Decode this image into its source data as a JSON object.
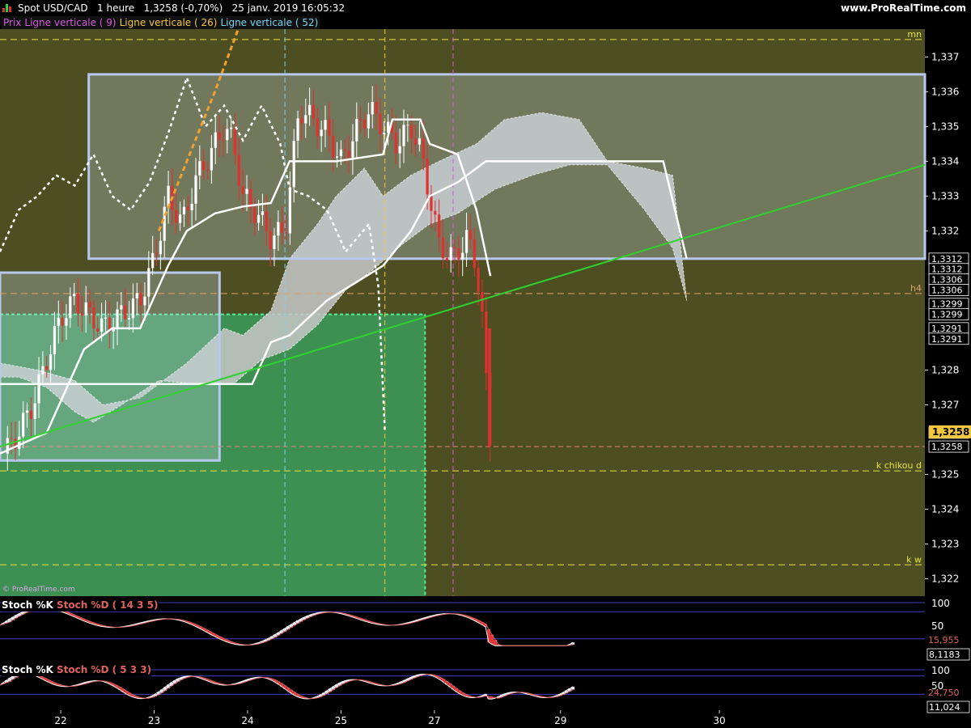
{
  "header": {
    "title": "Spot USD/CAD   1 heure   1,3258 (-0,70%)   25 janv. 2019 16:05:32",
    "brand": "www.ProRealTime.com",
    "watermark": "© ProRealTime.com"
  },
  "legend": [
    {
      "text": "Prix",
      "color": "#d65adf"
    },
    {
      "text": "Ligne verticale ( 9)",
      "color": "#d65adf"
    },
    {
      "text": "Ligne verticale ( 26)",
      "color": "#f2c640"
    },
    {
      "text": "Ligne verticale ( 52)",
      "color": "#7ad3f0"
    }
  ],
  "colors": {
    "background": "#4d4f22",
    "cloud": "#c8c8c8",
    "trendline": "#2ed22e",
    "box": "#b7c8ee",
    "level": "#e8e23c",
    "bear": "#e03030",
    "bull": "#ffffff",
    "green_zone": "#3c9a5a"
  },
  "chart_data": [
    {
      "type": "candlestick",
      "title": "Spot USD/CAD 1 heure",
      "x_ticks": [
        "22",
        "23",
        "24",
        "25",
        "27",
        "29",
        "30"
      ],
      "y_ticks": [
        "1,337",
        "1,336",
        "1,335",
        "1,334",
        "1,333",
        "1,332",
        "1,328",
        "1,327",
        "1,325",
        "1,324",
        "1,323",
        "1,322"
      ],
      "ylim": [
        1.3215,
        1.3378
      ],
      "price_labels": [
        {
          "text": "1,3312",
          "value": 1.3312
        },
        {
          "text": "1,3312",
          "value": 1.3309
        },
        {
          "text": "1,3306",
          "value": 1.3306
        },
        {
          "text": "1,3306",
          "value": 1.3303
        },
        {
          "text": "1,3299",
          "value": 1.3299
        },
        {
          "text": "1,3299",
          "value": 1.3296
        },
        {
          "text": "1,3291",
          "value": 1.3292
        },
        {
          "text": "1,3291",
          "value": 1.3289
        },
        {
          "text": "1,3258",
          "value": 1.3262
        },
        {
          "text": "1,3258",
          "value": 1.3258
        }
      ],
      "last_price": {
        "text": "1,3258",
        "value": 1.3262
      },
      "levels": [
        {
          "label": "mn",
          "value": 1.3375
        },
        {
          "label": "h4",
          "value": 1.3302
        },
        {
          "label": "k chikou d",
          "value": 1.3251
        },
        {
          "label": "k w",
          "value": 1.3224
        }
      ],
      "boxes": [
        {
          "name": "upper-range-box",
          "start": 21.45,
          "end": 30.4,
          "top": 1.3365,
          "bottom": 1.3312
        },
        {
          "name": "lower-range-box",
          "start": 20.5,
          "end": 22.85,
          "top": 1.3308,
          "bottom": 1.3254
        }
      ],
      "green_zone": {
        "start": 20.5,
        "end": 25.05,
        "top": 1.3296,
        "bottom": 1.3215
      },
      "vertical_lines": [
        {
          "x": 23.55,
          "color": "#7ad3f0"
        },
        {
          "x": 24.62,
          "color": "#f2c640"
        },
        {
          "x": 25.35,
          "color": "#d65adf"
        }
      ],
      "trendline": {
        "x": [
          20.5,
          30.4
        ],
        "y": [
          1.3258,
          1.3339
        ]
      },
      "xlim": [
        20.5,
        30.4
      ]
    },
    {
      "type": "line",
      "title": "Stoch %K  Stoch %D ( 14 3 5)",
      "y_ticks": [
        "100",
        "50"
      ],
      "ylim": [
        0,
        100
      ],
      "value_labels": [
        "15,955",
        "8,1183"
      ]
    },
    {
      "type": "line",
      "title": "Stoch %K  Stoch %D ( 5 3 3)",
      "y_ticks": [
        "100",
        "50"
      ],
      "ylim": [
        0,
        100
      ],
      "value_labels": [
        "24,750",
        "11,024"
      ]
    }
  ],
  "ind1": {
    "label_k": "Stoch %K",
    "label_d": "Stoch %D ( 14 3 5)"
  },
  "ind2": {
    "label_k": "Stoch %K",
    "label_d": "Stoch %D ( 5 3 3)"
  }
}
